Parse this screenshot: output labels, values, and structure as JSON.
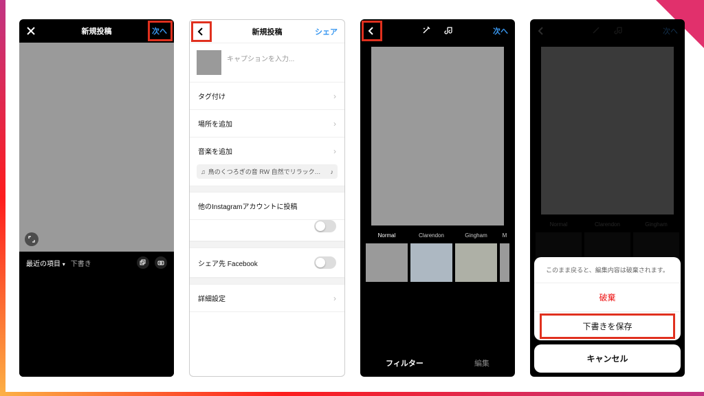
{
  "screen1": {
    "title": "新規投稿",
    "next": "次へ",
    "recent_label": "最近の項目",
    "draft_label": "下書き"
  },
  "screen2": {
    "title": "新規投稿",
    "share": "シェア",
    "caption_placeholder": "キャプションを入力...",
    "rows": {
      "tag": "タグ付け",
      "location": "場所を追加",
      "music": "音楽を追加",
      "music_chip": "鳥のくつろぎの音  RW 自然でリラックスできる音楽",
      "other_ig": "他のInstagramアカウントに投稿",
      "share_fb": "シェア先 Facebook",
      "advanced": "詳細設定"
    }
  },
  "screen3": {
    "next": "次へ",
    "filters": [
      "Normal",
      "Clarendon",
      "Gingham",
      "M"
    ],
    "tab_filter": "フィルター",
    "tab_edit": "編集"
  },
  "screen4": {
    "next": "次へ",
    "filters": [
      "Normal",
      "Clarendon",
      "Gingham"
    ],
    "sheet_message": "このまま戻ると、編集内容は破棄されます。",
    "discard": "破棄",
    "save_draft": "下書きを保存",
    "cancel": "キャンセル"
  }
}
